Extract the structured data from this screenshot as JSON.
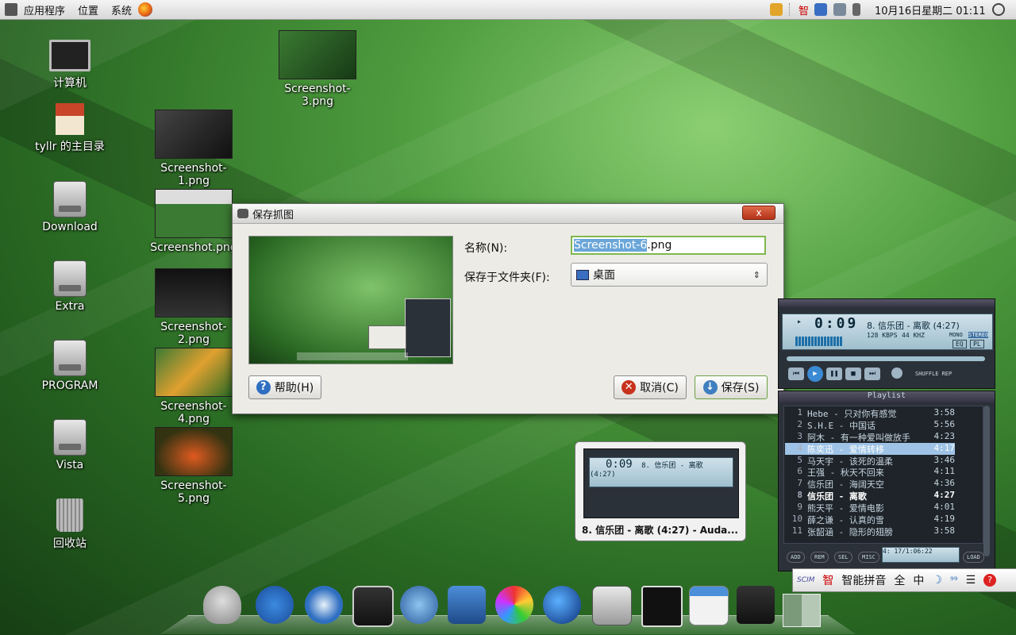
{
  "top_panel": {
    "menu": [
      "应用程序",
      "位置",
      "系统"
    ],
    "tray_text": "智",
    "clock": "10月16日星期二 01:11"
  },
  "desktop": {
    "icons": [
      "计算机",
      "tyllr 的主目录",
      "Download",
      "Extra",
      "PROGRAM",
      "Vista",
      "回收站"
    ],
    "files": [
      "Screenshot-3.png",
      "Screenshot-1.png",
      "Screenshot.png",
      "Screenshot-2.png",
      "Screenshot-4.png",
      "Screenshot-5.png"
    ]
  },
  "dialog": {
    "title": "保存抓图",
    "close_label": "x",
    "name_label": "名称(N):",
    "name_value_selected": "Screenshot-6",
    "name_value_rest": ".png",
    "folder_label": "保存于文件夹(F):",
    "folder_value": "桌面",
    "help_button": "帮助(H)",
    "cancel_button": "取消(C)",
    "save_button": "保存(S)"
  },
  "player": {
    "time": "0:09",
    "track": "8. 信乐团 - 离歌 (4:27)",
    "kbps": "128",
    "kbps_label": "KBPS",
    "khz": "44",
    "khz_label": "KHZ",
    "mono": "MONO",
    "stereo": "STEREO",
    "eq": "EQ",
    "pl": "PL",
    "shuffle": "SHUFFLE",
    "rep": "REP",
    "playlist_title": "Playlist",
    "playlist": [
      {
        "n": "1",
        "t": "Hebe - 只对你有感觉",
        "d": "3:58"
      },
      {
        "n": "2",
        "t": "S.H.E - 中国话",
        "d": "5:56"
      },
      {
        "n": "3",
        "t": "阿木 - 有一种爱叫做放手",
        "d": "4:23"
      },
      {
        "n": "4",
        "t": "陈奕迅 - 爱情转移",
        "d": "4:17"
      },
      {
        "n": "5",
        "t": "马天宇 - 该死的温柔",
        "d": "3:46"
      },
      {
        "n": "6",
        "t": "王强 - 秋天不回来",
        "d": "4:11"
      },
      {
        "n": "7",
        "t": "信乐团 - 海阔天空",
        "d": "4:36"
      },
      {
        "n": "8",
        "t": "信乐团 - 离歌",
        "d": "4:27"
      },
      {
        "n": "9",
        "t": "熊天平 - 爱情电影",
        "d": "4:01"
      },
      {
        "n": "10",
        "t": "薛之谦 - 认真的雪",
        "d": "4:19"
      },
      {
        "n": "11",
        "t": "张韶涵 - 隐形的翅膀",
        "d": "3:58"
      }
    ],
    "bottom_buttons": [
      "ADD",
      "REM",
      "SEL",
      "MISC",
      "LOAD"
    ],
    "status": "4: 17/1:06:22"
  },
  "mini_player": {
    "time": "0:09",
    "track": "8. 信乐团 - 离歌 (4:27)",
    "caption": "8. 信乐团 - 离歌 (4:27) - Auda..."
  },
  "ime": {
    "logo": "SCIM",
    "zhi": "智",
    "name": "智能拼音",
    "full": "全",
    "zh": "中"
  },
  "colors": {
    "selection": "#6aa6d8",
    "playlist_highlight": "#9ec3e6",
    "panel": "#dcdcdc"
  }
}
